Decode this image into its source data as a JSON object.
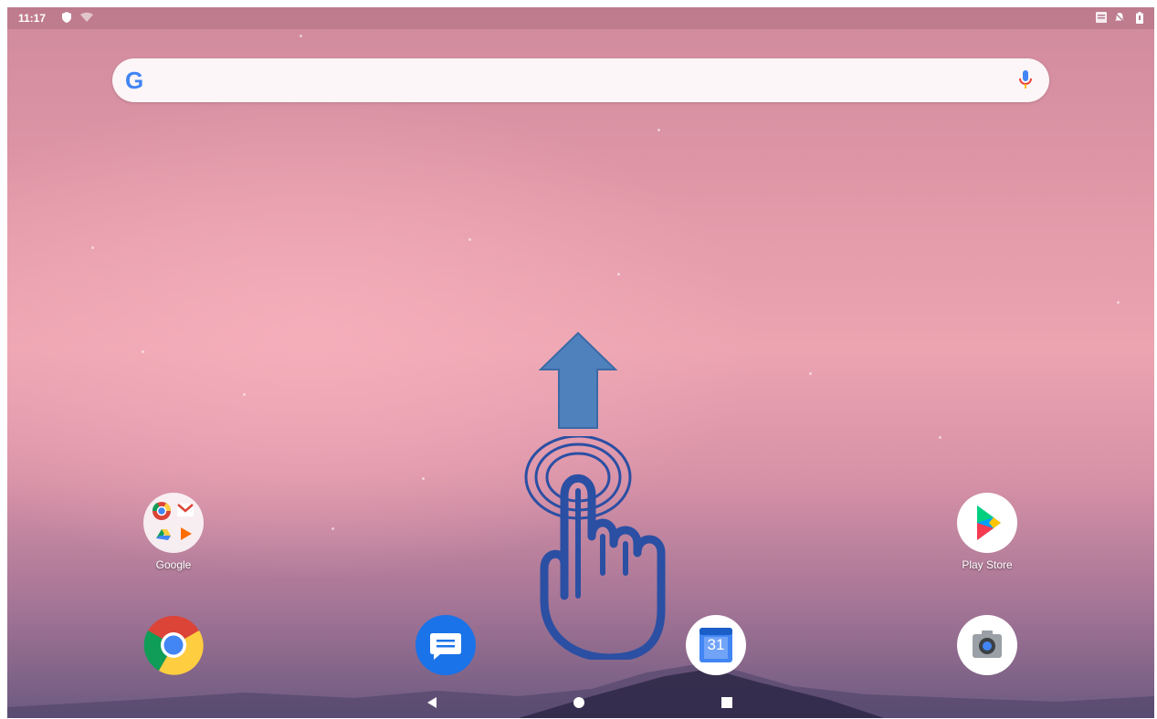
{
  "status_bar": {
    "time": "11:17",
    "left_icons": [
      "shield-icon",
      "wifi-off-icon"
    ],
    "right_icons": [
      "vpn-icon",
      "notifications-off-icon",
      "battery-icon"
    ]
  },
  "search_bar": {
    "logo_letter": "G",
    "icon": "mic-icon"
  },
  "swipe_hint": {
    "arrow": "up-arrow-icon",
    "hand": "tap-hand-icon",
    "arrow_color": "#4f81bd",
    "hand_color": "#2b4fa3"
  },
  "home_apps": [
    {
      "label": "Google",
      "icon": "google-folder-icon"
    },
    {
      "label": "Play Store",
      "icon": "play-store-icon"
    }
  ],
  "dock_apps": [
    {
      "label": "Chrome",
      "icon": "chrome-icon"
    },
    {
      "label": "Messages",
      "icon": "messages-icon"
    },
    {
      "label": "Calendar",
      "icon": "calendar-icon",
      "badge": "31"
    },
    {
      "label": "Camera",
      "icon": "camera-icon"
    }
  ],
  "nav_bar": {
    "buttons": [
      "back-icon",
      "home-icon",
      "recents-icon"
    ]
  }
}
